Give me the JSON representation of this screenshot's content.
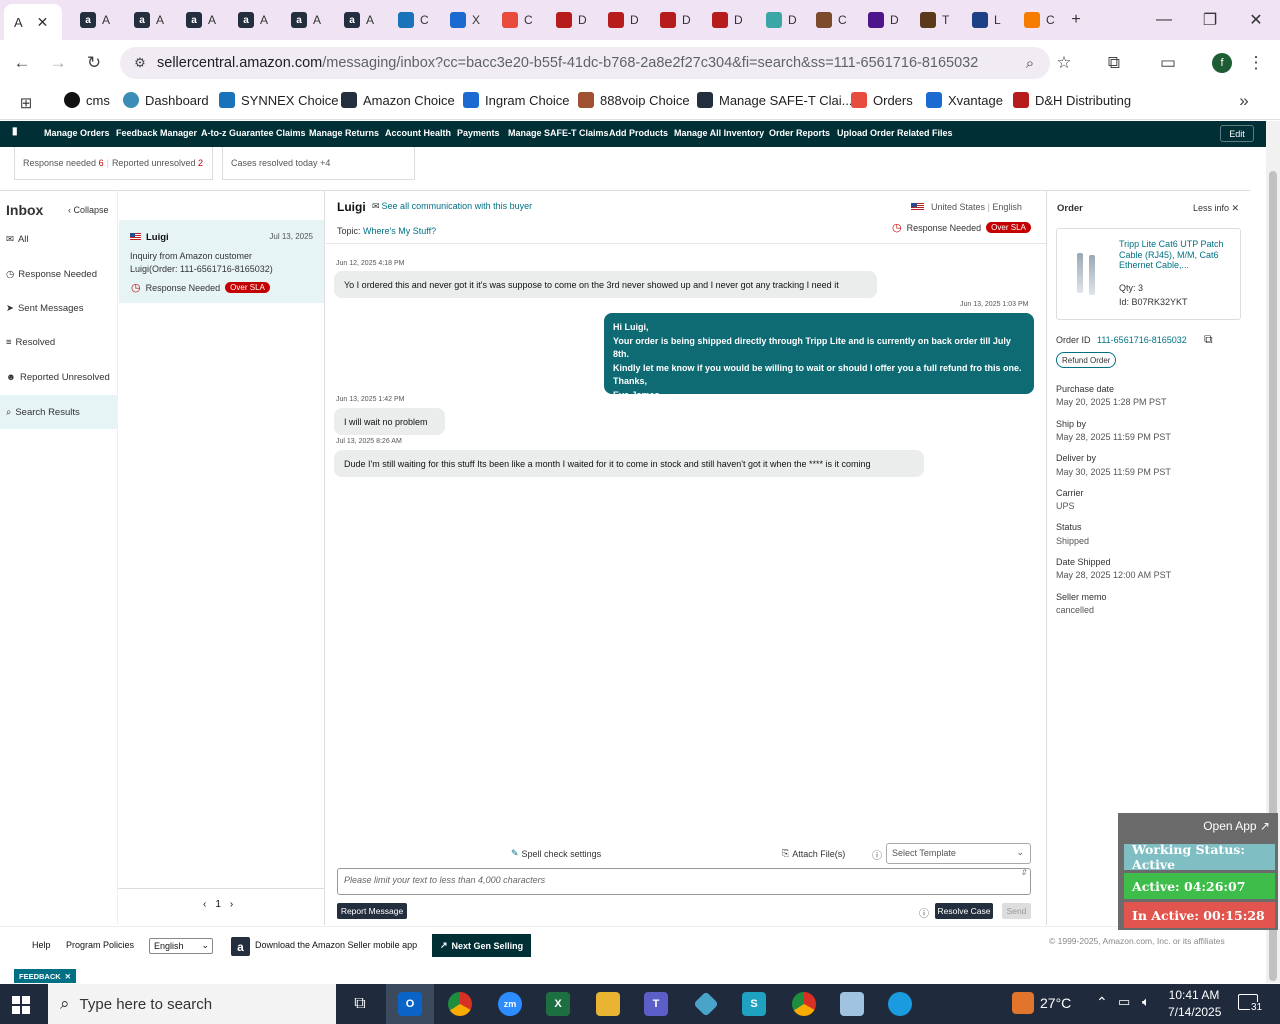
{
  "browser": {
    "tabs": [
      {
        "letter": "A",
        "icon": "amazon-icon"
      },
      {
        "letter": "A",
        "icon": "amazon-icon"
      },
      {
        "letter": "A",
        "icon": "amazon-icon"
      },
      {
        "letter": "A",
        "icon": "amazon-icon"
      },
      {
        "letter": "A",
        "icon": "amazon-icon"
      },
      {
        "letter": "A",
        "icon": "amazon-icon"
      },
      {
        "letter": "A",
        "icon": "amazon-icon"
      },
      {
        "letter": "C",
        "icon": "ec-icon"
      },
      {
        "letter": "X",
        "icon": "xvantage-icon"
      },
      {
        "letter": "C",
        "icon": "s-logo-icon"
      },
      {
        "letter": "D",
        "icon": "dh-icon"
      },
      {
        "letter": "D",
        "icon": "dh-icon"
      },
      {
        "letter": "D",
        "icon": "dh-icon"
      },
      {
        "letter": "D",
        "icon": "dh-icon"
      },
      {
        "letter": "D",
        "icon": "teal-icon"
      },
      {
        "letter": "C",
        "icon": "people-icon"
      },
      {
        "letter": "D",
        "icon": "fedex-icon"
      },
      {
        "letter": "T",
        "icon": "ups-icon"
      },
      {
        "letter": "L",
        "icon": "usps-icon"
      },
      {
        "letter": "C",
        "icon": "orange-icon"
      }
    ],
    "url_host": "sellercentral.amazon.com",
    "url_path": "/messaging/inbox?cc=bacc3e20-b55f-41dc-b768-2a8e2f27c304&fi=search&ss=111-6561716-8165032",
    "profile_letter": "f",
    "bookmarks": [
      "cms",
      "Dashboard",
      "SYNNEX Choice",
      "Amazon Choice",
      "Ingram Choice",
      "888voip Choice",
      "Manage SAFE-T Clai...",
      "Orders",
      "Xvantage",
      "D&H Distributing"
    ]
  },
  "sellernav": {
    "items": [
      "Manage Orders",
      "Feedback Manager",
      "A-to-z Guarantee Claims",
      "Manage Returns",
      "Account Health",
      "Payments",
      "Manage SAFE-T Claims",
      "Add Products",
      "Manage All Inventory",
      "Order Reports",
      "Upload Order Related Files"
    ],
    "edit": "Edit"
  },
  "stats": {
    "response_needed_label": "Response needed",
    "response_needed_count": "6",
    "reported_unresolved_label": "Reported unresolved",
    "reported_unresolved_count": "2",
    "cases_resolved_label": "Cases resolved today",
    "cases_resolved_count": "+4"
  },
  "sidebar": {
    "title": "Inbox",
    "collapse": "Collapse",
    "items": [
      "All",
      "Response Needed",
      "Sent Messages",
      "Resolved",
      "Reported Unresolved",
      "Search Results"
    ]
  },
  "conversation": {
    "name": "Luigi",
    "date": "Jul 13, 2025",
    "preview": "Inquiry from Amazon customer Luigi(Order: 111-6561716-8165032)",
    "status": "Response Needed",
    "badge": "Over SLA",
    "page": "1"
  },
  "chat": {
    "buyer": "Luigi",
    "see_all": "See all communication with this buyer",
    "country": "United States",
    "language": "English",
    "topic_label": "Topic:",
    "topic": "Where's My Stuff?",
    "status": "Response Needed",
    "badge": "Over SLA",
    "messages": [
      {
        "time": "Jun 12, 2025 4:18 PM",
        "text": "Yo I ordered this and never got it it's was suppose to come on the 3rd never showed up and I never got any tracking I need it"
      },
      {
        "time": "Jun 13, 2025 1:03 PM",
        "lines": [
          "Hi Luigi,",
          "Your order is being shipped directly through Tripp Lite and is currently on back order till July 8th.",
          "Kindly let me know if you would be willing to wait or should I offer you a full refund fro this one.",
          "Thanks,",
          "Eva James."
        ]
      },
      {
        "time": "Jun 13, 2025 1:42 PM",
        "text": "I will wait no problem"
      },
      {
        "time": "Jul 13, 2025 8:26 AM",
        "text": "Dude I'm still waiting for this stuff Its been like a month I waited for it to come in stock and still haven't got it when the **** is it coming"
      }
    ],
    "spell_check": "Spell check settings",
    "attach": "Attach File(s)",
    "template_placeholder": "Select Template",
    "input_placeholder": "Please limit your text to less than 4,000 characters",
    "report": "Report Message",
    "resolve": "Resolve Case",
    "send": "Send"
  },
  "order": {
    "title": "Order",
    "less_info": "Less info",
    "product_title": "Tripp Lite Cat6 UTP Patch Cable (RJ45), M/M, Cat6 Ethernet Cable,...",
    "qty": "Qty: 3",
    "id": "Id: B07RK32YKT",
    "order_id_label": "Order ID",
    "order_id": "111-6561716-8165032",
    "refund": "Refund Order",
    "fields": [
      {
        "label": "Purchase date",
        "value": "May 20, 2025 1:28 PM PST"
      },
      {
        "label": "Ship by",
        "value": "May 28, 2025 11:59 PM PST"
      },
      {
        "label": "Deliver by",
        "value": "May 30, 2025 11:59 PM PST"
      },
      {
        "label": "Carrier",
        "value": "UPS"
      },
      {
        "label": "Status",
        "value": "Shipped"
      },
      {
        "label": "Date Shipped",
        "value": "May 28, 2025 12:00 AM PST"
      },
      {
        "label": "Seller memo",
        "value": "cancelled"
      }
    ]
  },
  "footer": {
    "help": "Help",
    "policies": "Program Policies",
    "language": "English",
    "download": "Download the Amazon Seller mobile app",
    "next_gen": "Next Gen Selling",
    "copyright": "© 1999-2025, Amazon.com, Inc. or its affiliates",
    "feedback": "FEEDBACK"
  },
  "widget": {
    "open_app": "Open App ↗",
    "working": "Working Status: Active",
    "active": "Active: 04:26:07",
    "inactive": "In Active: 00:15:28"
  },
  "taskbar": {
    "search_placeholder": "Type here to search",
    "temperature": "27°C",
    "time": "10:41 AM",
    "date": "7/14/2025",
    "notifications": "31"
  }
}
